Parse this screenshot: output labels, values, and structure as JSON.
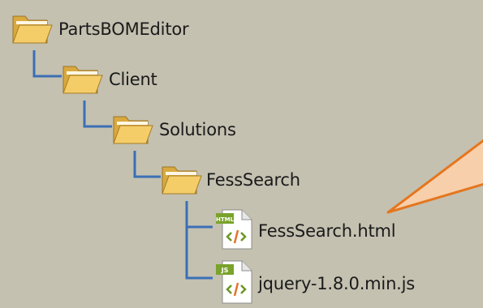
{
  "tree": {
    "items": [
      {
        "label": "PartsBOMEditor",
        "type": "folder",
        "icon": "folder-icon"
      },
      {
        "label": "Client",
        "type": "folder",
        "icon": "folder-icon"
      },
      {
        "label": "Solutions",
        "type": "folder",
        "icon": "folder-icon"
      },
      {
        "label": "FessSearch",
        "type": "folder",
        "icon": "folder-icon"
      },
      {
        "label": "FessSearch.html",
        "type": "file",
        "icon": "html-file-icon",
        "badge": "HTML"
      },
      {
        "label": "jquery-1.8.0.min.js",
        "type": "file",
        "icon": "js-file-icon",
        "badge": "JS"
      }
    ]
  },
  "colors": {
    "background": "#c4c1b1",
    "connector": "#3b6fb6",
    "callout_fill": "#f7cfab",
    "callout_stroke": "#e5761e"
  }
}
